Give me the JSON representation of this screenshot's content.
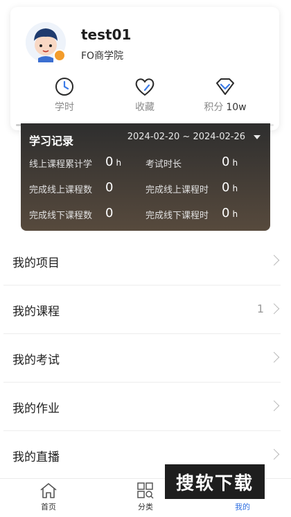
{
  "profile": {
    "username": "test01",
    "school": "FO商学院",
    "badge_color": "#f39c2b"
  },
  "stats": [
    {
      "icon": "clock-icon",
      "label": "学时",
      "value": ""
    },
    {
      "icon": "heart-icon",
      "label": "收藏",
      "value": ""
    },
    {
      "icon": "diamond-icon",
      "label": "积分",
      "value": "10w"
    }
  ],
  "record": {
    "title": "学习记录",
    "date_range": "2024-02-20 ~ 2024-02-26",
    "items": [
      {
        "label": "线上课程累计学",
        "value": "0",
        "unit": "h"
      },
      {
        "label": "考试时长",
        "value": "0",
        "unit": "h"
      },
      {
        "label": "完成线上课程数",
        "value": "0",
        "unit": ""
      },
      {
        "label": "完成线上课程时",
        "value": "0",
        "unit": "h"
      },
      {
        "label": "完成线下课程数",
        "value": "0",
        "unit": ""
      },
      {
        "label": "完成线下课程时",
        "value": "0",
        "unit": "h"
      }
    ]
  },
  "menu": [
    {
      "label": "我的项目",
      "count": ""
    },
    {
      "label": "我的课程",
      "count": "1"
    },
    {
      "label": "我的考试",
      "count": ""
    },
    {
      "label": "我的作业",
      "count": ""
    },
    {
      "label": "我的直播",
      "count": ""
    }
  ],
  "tabs": [
    {
      "icon": "home-icon",
      "label": "首页",
      "active": false
    },
    {
      "icon": "category-icon",
      "label": "分类",
      "active": false
    },
    {
      "icon": "profile-icon",
      "label": "我的",
      "active": true
    }
  ],
  "accent_color": "#2f6fe0",
  "watermark_text": "搜软下载"
}
